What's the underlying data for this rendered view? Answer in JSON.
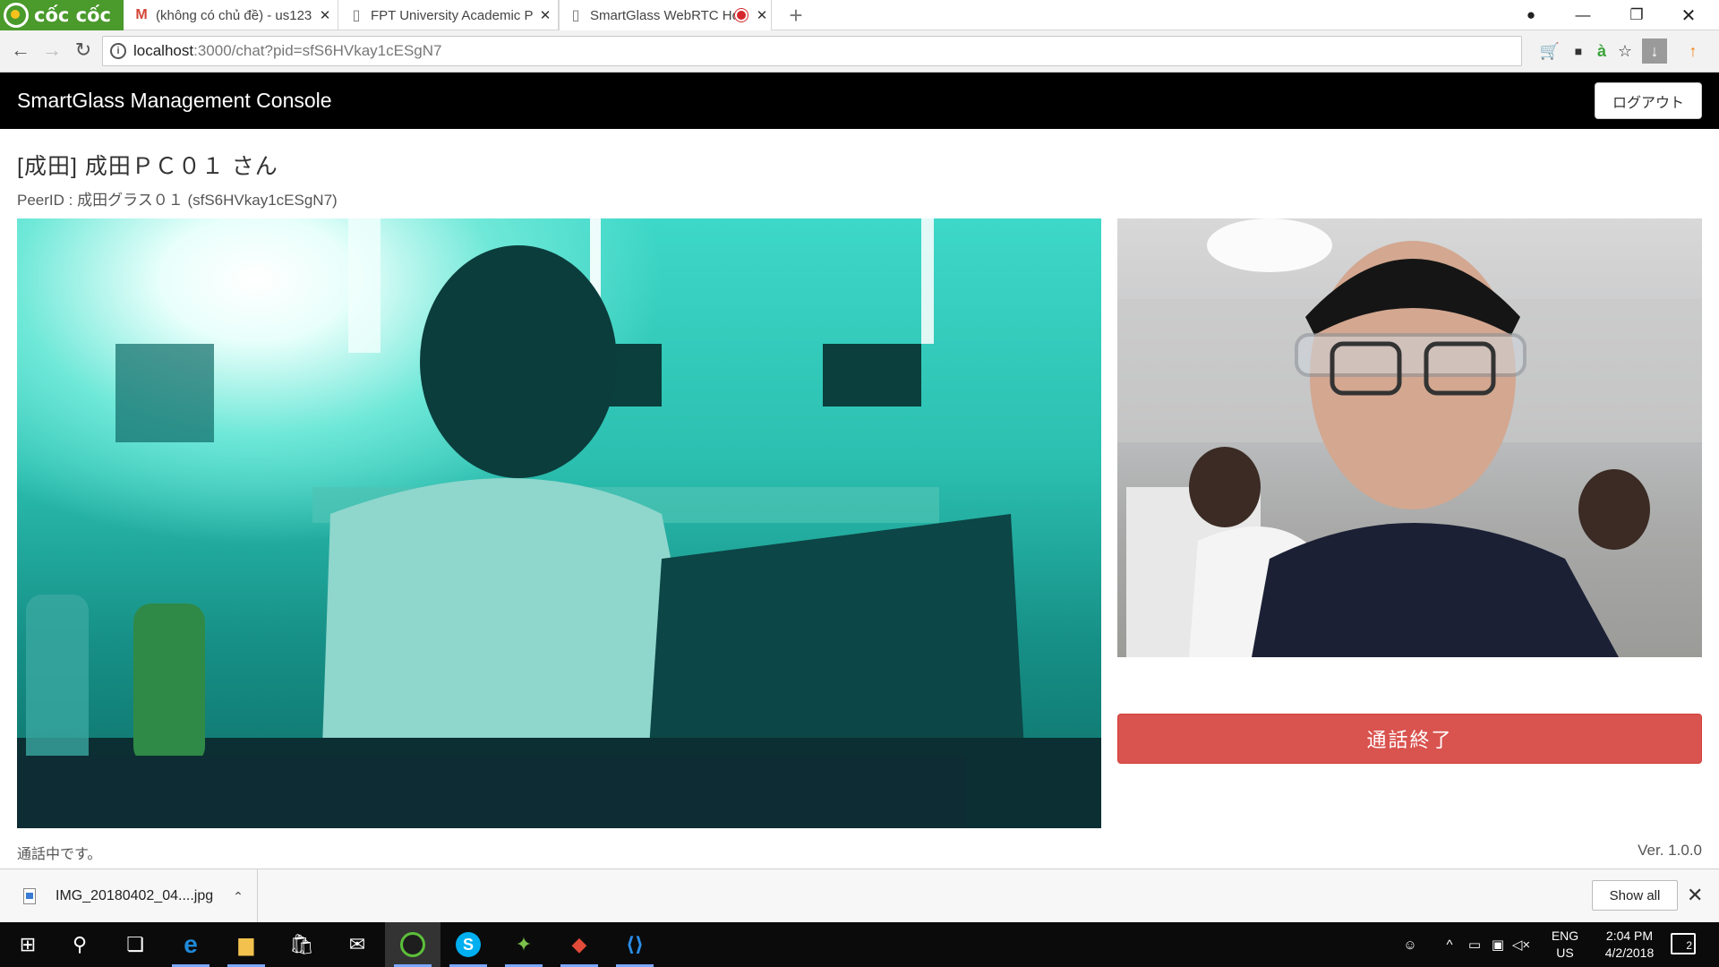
{
  "browser": {
    "brand": "cốc cốc",
    "tabs": [
      {
        "favicon": "gmail-icon",
        "title": "(không có chủ đề) - us123"
      },
      {
        "favicon": "page-icon",
        "title": "FPT University Academic P"
      },
      {
        "favicon": "page-icon",
        "title": "SmartGlass WebRTC Hc",
        "active": true,
        "recording": true
      }
    ],
    "url_host": "localhost",
    "url_path": ":3000/chat?pid=sfS6HVkay1cESgN7"
  },
  "app": {
    "title": "SmartGlass Management Console",
    "logout_label": "ログアウト"
  },
  "call": {
    "title": "[成田] 成田ＰＣ０１ さん",
    "peer_id": "PeerID : 成田グラス０１ (sfS6HVkay1cESgN7)",
    "end_call_label": "通話終了",
    "status": "通話中です。",
    "version": "Ver. 1.0.0"
  },
  "downloads": {
    "file_name": "IMG_20180402_04....jpg",
    "show_all_label": "Show all"
  },
  "taskbar": {
    "language": "ENG",
    "region": "US",
    "time": "2:04 PM",
    "date": "4/2/2018",
    "notification_count": "2"
  },
  "colors": {
    "brand_green": "#4a9a2c",
    "header_black": "#000000",
    "end_call_red": "#d9534f",
    "remote_video_tint": "#2bbfb0"
  }
}
